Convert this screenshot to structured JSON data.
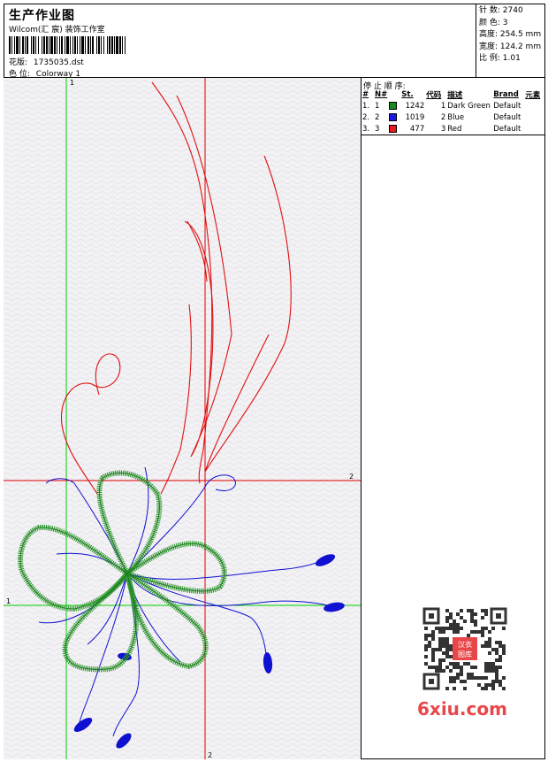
{
  "header": {
    "title": "生产作业图",
    "company": "Wilcom(汇 宸) 装饰工作室",
    "design_label": "花版:",
    "design_value": "1735035.dst",
    "colorway_label": "色 位:",
    "colorway_value": "Colorway 1"
  },
  "stats": [
    {
      "label": "针 数:",
      "value": "2740"
    },
    {
      "label": "颜 色:",
      "value": "3"
    },
    {
      "label": "高度:",
      "value": "254.5 mm"
    },
    {
      "label": "宽度:",
      "value": "124.2 mm"
    },
    {
      "label": "比 例:",
      "value": "1.01"
    }
  ],
  "stop_sequence": {
    "title": "停 止 顺 序:",
    "headers": [
      "#",
      "N#",
      "St.",
      "代码",
      "描述",
      "Brand",
      "元素"
    ],
    "rows": [
      {
        "num": "1.",
        "n": "1",
        "color": "#1a8a1a",
        "stitches": "1242",
        "code": "1",
        "desc": "Dark Green",
        "brand": "Default"
      },
      {
        "num": "2.",
        "n": "2",
        "color": "#1a1ae6",
        "stitches": "1019",
        "code": "2",
        "desc": "Blue",
        "brand": "Default"
      },
      {
        "num": "3.",
        "n": "3",
        "color": "#e61a1a",
        "stitches": "477",
        "code": "3",
        "desc": "Red",
        "brand": "Default"
      }
    ]
  },
  "guides": {
    "v1": "1",
    "h1": "1",
    "v2": "2",
    "h2": "2"
  },
  "watermark": {
    "qr_text": "汉衣图库",
    "site": "6xiu.com"
  },
  "colors": {
    "green": "#2d9a2d",
    "blue": "#1010d0",
    "red": "#e01010",
    "guide_green": "#00d000",
    "guide_red": "#e00000",
    "canvas_bg": "#f2f1f4"
  }
}
